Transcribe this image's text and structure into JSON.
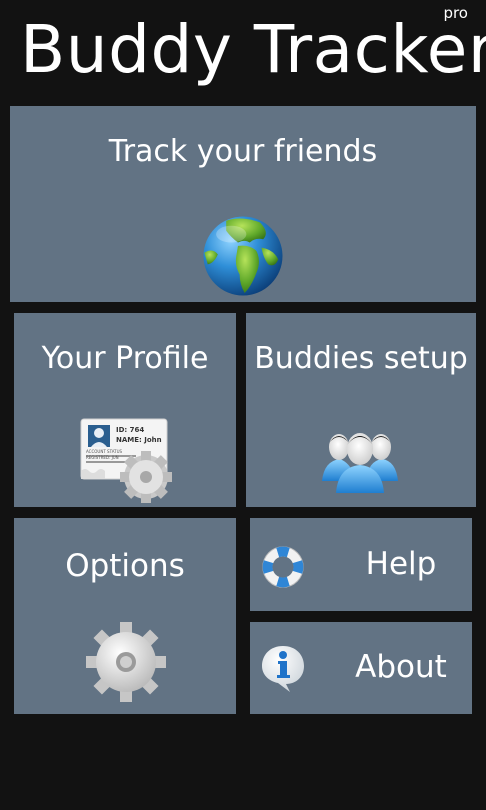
{
  "app": {
    "title": "Buddy Tracker",
    "edition": "pro"
  },
  "tiles": {
    "track": {
      "label": "Track your friends",
      "icon": "globe-icon"
    },
    "profile": {
      "label": "Your Profile",
      "icon": "id-card-gear-icon",
      "card_id": "ID: 764",
      "card_name": "NAME: John",
      "card_status": "ACCOUNT STATUS",
      "card_registered": "REGISTRED: JUN"
    },
    "buddies": {
      "label": "Buddies setup",
      "icon": "users-group-icon"
    },
    "options": {
      "label": "Options",
      "icon": "gear-icon"
    },
    "help": {
      "label": "Help",
      "icon": "lifebuoy-icon"
    },
    "about": {
      "label": "About",
      "icon": "info-bubble-icon"
    }
  },
  "colors": {
    "background": "#121212",
    "tile": "#627384",
    "text": "#ffffff"
  }
}
